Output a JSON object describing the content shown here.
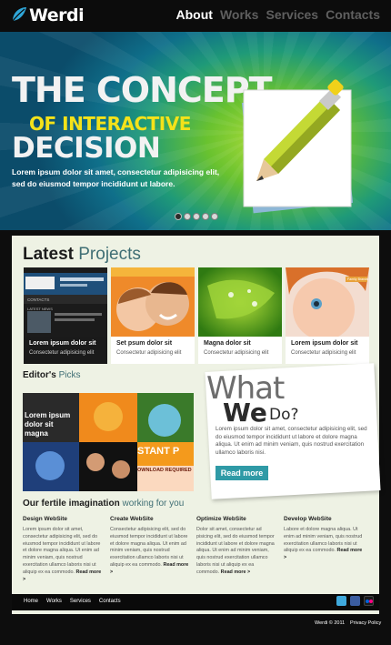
{
  "brand": {
    "name": "Werdi"
  },
  "nav": [
    {
      "label": "About",
      "active": true
    },
    {
      "label": "Works",
      "active": false
    },
    {
      "label": "Services",
      "active": false
    },
    {
      "label": "Contacts",
      "active": false
    }
  ],
  "hero": {
    "title_line1": "The Concept",
    "title_line2": "of interactive",
    "title_line3": "Decision",
    "text": "Lorem ipsum dolor sit amet, consectetur adipisicing elit, sed do eiusmod tempor incididunt ut labore.",
    "slide_count": 5,
    "active_slide": 1
  },
  "latest_projects": {
    "title_bold": "Latest",
    "title_light": "Projects",
    "items": [
      {
        "caption": "Lorem ipsum dolor sit",
        "sub": "Consectetur adipisicing elit"
      },
      {
        "caption": "Set psum dolor sit",
        "sub": "Consectetur adipisicing elit"
      },
      {
        "caption": "Magna dolor sit",
        "sub": "Consectetur adipisicing elit"
      },
      {
        "caption": "Lorem ipsum dolor sit",
        "sub": "Consectetur adipisicing elit"
      }
    ],
    "thumb_labels": {
      "contacts": "CONTACTS",
      "latest_news": "LATEST NEWS",
      "family": "Family Brands"
    }
  },
  "editors_picks": {
    "title_bold": "Editor's",
    "title_light": "Picks",
    "overlay_text": "Lorem ipsum dolor sit magna",
    "banner_big": "STANT P",
    "banner_small": "OWNLOAD REQUIRED"
  },
  "what_we_do": {
    "what": "What",
    "we": "We",
    "do": "Do?",
    "text": "Lorem ipsum dolor sit amet, consectetur adipisicing elit, sed do eiusmod tempor incididunt ut labore et dolore magna aliqua. Ut enim ad minim veniam, quis nostrud exercitation ullamco laboris nisi.",
    "button": "Read more"
  },
  "fertile": {
    "title_bold": "Our fertile imagination",
    "title_light": "working for you",
    "columns": [
      {
        "heading": "Design WebSite",
        "text": "Lorem ipsum dolor sit amet, consectetur adipisicing elit, sed do eiusmod tempor incididunt ut labore et dolore magna aliqua. Ut enim ad minim veniam, quis nostrud exercitation ullamco laboris nisi ut aliquip ex ea commodo.",
        "more": "Read more >"
      },
      {
        "heading": "Create WebSite",
        "text": "Consectetur adipisicing elit, sed do eiusmod tempor incididunt ut labore et dolore magna aliqua. Ut enim ad minim veniam, quis nostrud exercitation ullamco laboris nisi ut aliquip ex ea commodo.",
        "more": "Read more >"
      },
      {
        "heading": "Optimize WebSite",
        "text": "Dolor sit amet, consectetur ad pisicing elit, sed do eiusmod tempor incididunt ut labore et dolore magna aliqua. Ut enim ad minim veniam, quis nostrud exercitation ullamco laboris nisi ut aliquip ex ea commodo.",
        "more": "Read more >"
      },
      {
        "heading": "Develop WebSite",
        "text": "Labore et dolore magna aliqua. Ut enim ad minim veniam, quis nostrud exercitation ullamco laboris nisi ut aliquip ex ea commodo.",
        "more": "Read more >"
      }
    ]
  },
  "footer": {
    "links": [
      "Home",
      "Works",
      "Services",
      "Contacts"
    ],
    "copyright": "Werdi © 2011",
    "privacy": "Privacy Policy",
    "social": [
      "twitter-icon",
      "facebook-icon",
      "flickr-icon"
    ]
  },
  "colors": {
    "accent": "#2f9aa6",
    "title_yellow": "#f4e21a",
    "panel_bg": "#eef2e4"
  }
}
